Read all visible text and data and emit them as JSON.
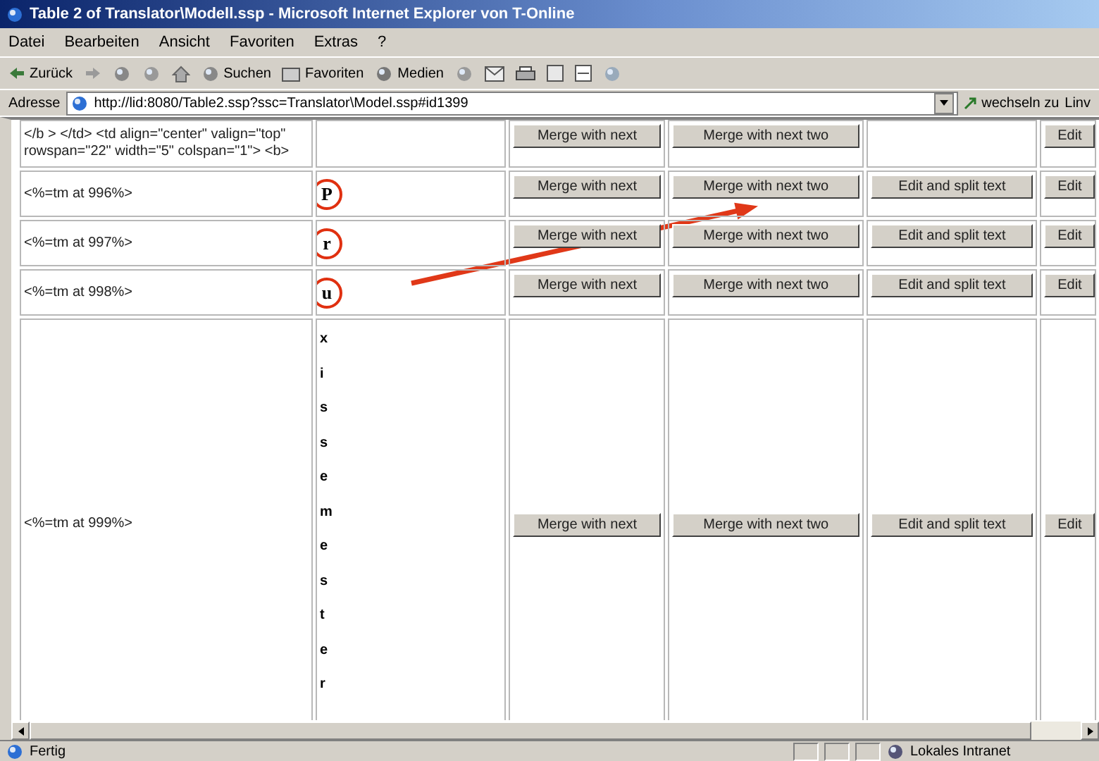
{
  "window": {
    "title": "Table 2 of Translator\\Modell.ssp - Microsoft Internet Explorer von T-Online"
  },
  "menu": [
    "Datei",
    "Bearbeiten",
    "Ansicht",
    "Favoriten",
    "Extras",
    "?"
  ],
  "toolbar": [
    {
      "kind": "back",
      "label": "Zurück"
    },
    {
      "kind": "forward"
    },
    {
      "kind": "stop"
    },
    {
      "kind": "refresh"
    },
    {
      "kind": "home"
    },
    {
      "kind": "search",
      "label": "Suchen"
    },
    {
      "kind": "favorites",
      "label": "Favoriten"
    },
    {
      "kind": "media",
      "label": "Medien"
    },
    {
      "kind": "history"
    },
    {
      "kind": "mail"
    },
    {
      "kind": "print"
    },
    {
      "kind": "edit"
    },
    {
      "kind": "discuss"
    },
    {
      "kind": "messenger"
    }
  ],
  "address": {
    "label": "Adresse",
    "value": "http://lid:8080/Table2.ssp?ssc=Translator\\Model.ssp#id1399",
    "go": "wechseln zu",
    "links": "Linv"
  },
  "rows": [
    {
      "kind": "text",
      "source": "</b > </td> <td align=\"center\" valign=\"top\" rowspan=\"22\" width=\"5\" colspan=\"1\"> <b>",
      "letters": [],
      "merge": "Merge with next",
      "merge_two": "Merge with next two",
      "edit": "Edit"
    },
    {
      "kind": "text",
      "source": "<%=tm at 996%>",
      "letters": [
        "P"
      ],
      "circled": true,
      "merge": "Merge with next",
      "merge_two": "Merge with next two",
      "split": "Edit and split text",
      "edit": "Edit"
    },
    {
      "kind": "text",
      "source": "<%=tm at 997%>",
      "letters": [
        "r"
      ],
      "circled": true,
      "merge": "Merge with next",
      "merge_two": "Merge with next two",
      "split": "Edit and split text",
      "edit": "Edit"
    },
    {
      "kind": "text",
      "source": "<%=tm at 998%>",
      "letters": [
        "u"
      ],
      "circled": true,
      "merge": "Merge with next",
      "merge_two": "Merge with next two",
      "split": "Edit and split text",
      "edit": "Edit"
    },
    {
      "kind": "vertical",
      "source": "<%=tm at 999%>",
      "letters": [
        "x",
        "i",
        "s",
        "s",
        "e",
        "m",
        "e",
        "s",
        "t",
        "e",
        "r"
      ],
      "merge": "Merge with next",
      "merge_two": "Merge with next two",
      "split": "Edit and split text",
      "edit": "Edit"
    }
  ],
  "status_bar": {
    "text": "Fertig",
    "zone": "Lokales Intranet"
  }
}
